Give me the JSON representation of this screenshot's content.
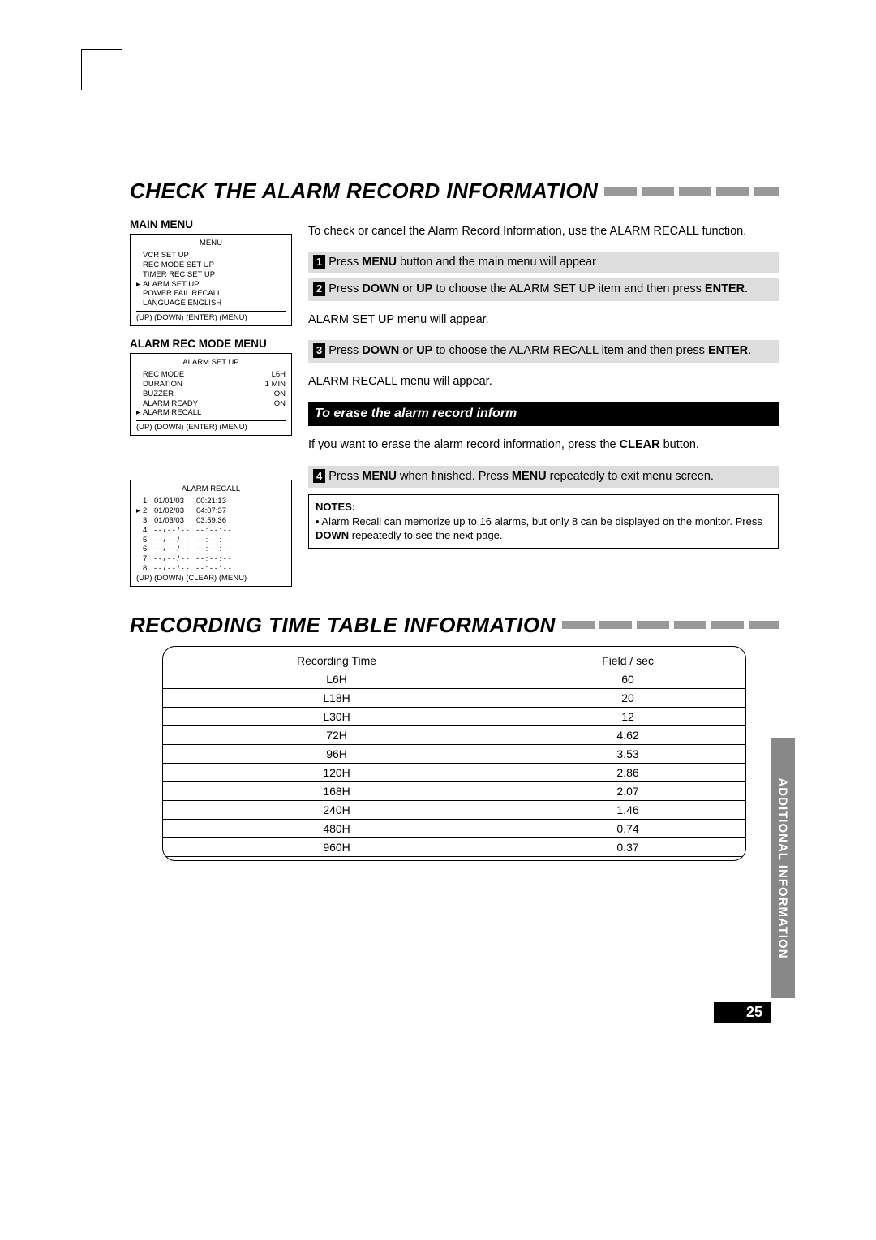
{
  "titles": {
    "section1": "CHECK THE ALARM RECORD INFORMATION",
    "section2": "RECORDING TIME TABLE INFORMATION"
  },
  "left": {
    "mainMenuLabel": "MAIN MENU",
    "alarmRecLabel": "ALARM REC MODE MENU",
    "mainMenu": {
      "title": "MENU",
      "items": [
        "VCR SET UP",
        "REC MODE SET UP",
        "TIMER REC SET UP",
        "ALARM SET UP",
        "POWER FAIL RECALL",
        "LANGUAGE  ENGLISH"
      ],
      "selectedIndex": 3,
      "foot": "(UP) (DOWN) (ENTER) (MENU)"
    },
    "alarmSetUp": {
      "title": "ALARM SET UP",
      "rows": [
        {
          "label": "REC MODE",
          "value": "L6H"
        },
        {
          "label": "DURATION",
          "value": "1 MIN"
        },
        {
          "label": "BUZZER",
          "value": "ON"
        },
        {
          "label": "ALARM READY",
          "value": "ON"
        },
        {
          "label": "ALARM RECALL",
          "value": ""
        }
      ],
      "selectedIndex": 4,
      "foot": "(UP) (DOWN) (ENTER) (MENU)"
    },
    "alarmRecall": {
      "title": "ALARM RECALL",
      "rows": [
        {
          "n": "1",
          "date": "01/01/03",
          "time": "00:21:13"
        },
        {
          "n": "2",
          "date": "01/02/03",
          "time": "04:07:37"
        },
        {
          "n": "3",
          "date": "01/03/03",
          "time": "03:59:36"
        },
        {
          "n": "4",
          "date": "- - / - - / - -",
          "time": "- - : - - : - -"
        },
        {
          "n": "5",
          "date": "- - / - - / - -",
          "time": "- - : - - : - -"
        },
        {
          "n": "6",
          "date": "- - / - - / - -",
          "time": "- - : - - : - -"
        },
        {
          "n": "7",
          "date": "- - / - - / - -",
          "time": "- - : - - : - -"
        },
        {
          "n": "8",
          "date": "- - / - - / - -",
          "time": "- - : - - : - -"
        }
      ],
      "selectedIndex": 1,
      "foot": "(UP) (DOWN) (CLEAR) (MENU)"
    }
  },
  "right": {
    "intro1": "To check or cancel the Alarm Record Information, use the ALARM RECALL function.",
    "step1_a": "Press ",
    "step1_b": "MENU",
    "step1_c": " button and the main menu will appear",
    "step2_a": "Press ",
    "step2_b": "DOWN",
    "step2_c": " or ",
    "step2_d": "UP",
    "step2_e": " to choose the ALARM SET UP item and then press ",
    "step2_f": "ENTER",
    "step2_g": ".",
    "after2": "ALARM SET UP menu will appear.",
    "step3_a": "Press ",
    "step3_b": "DOWN",
    "step3_c": " or ",
    "step3_d": "UP",
    "step3_e": " to choose the ALARM RECALL item and then press ",
    "step3_f": "ENTER",
    "step3_g": ".",
    "after3": "ALARM RECALL menu will appear.",
    "eraseTitle": "To erase the alarm record inform",
    "erase1": "If you want to erase the alarm record information, press the ",
    "erase2": "CLEAR",
    "erase3": " button.",
    "step4_a": "Press ",
    "step4_b": "MENU",
    "step4_c": " when finished. Press ",
    "step4_d": "MENU",
    "step4_e": " repeatedly to exit menu screen.",
    "notesTitle": "NOTES:",
    "notesBody_a": "• Alarm Recall can memorize up to 16 alarms, but only 8 can be displayed on the monitor. Press ",
    "notesBody_b": "DOWN",
    "notesBody_c": " repeatedly to see the next page.",
    "nums": {
      "s1": "1",
      "s2": "2",
      "s3": "3",
      "s4": "4"
    }
  },
  "chart_data": {
    "type": "table",
    "title": "Recording Time Table",
    "columns": [
      "Recording Time",
      "Field / sec"
    ],
    "rows": [
      [
        "L6H",
        "60"
      ],
      [
        "L18H",
        "20"
      ],
      [
        "L30H",
        "12"
      ],
      [
        "72H",
        "4.62"
      ],
      [
        "96H",
        "3.53"
      ],
      [
        "120H",
        "2.86"
      ],
      [
        "168H",
        "2.07"
      ],
      [
        "240H",
        "1.46"
      ],
      [
        "480H",
        "0.74"
      ],
      [
        "960H",
        "0.37"
      ]
    ]
  },
  "sideTab": "ADDITIONAL INFORMATION",
  "pageNum": "25"
}
